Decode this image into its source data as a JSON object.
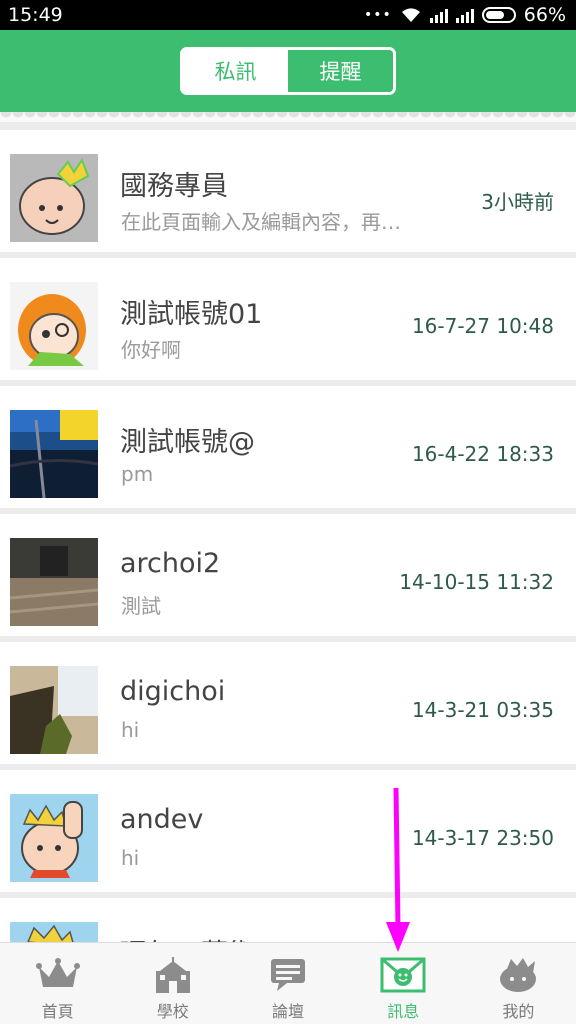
{
  "status_bar": {
    "time": "15:49",
    "dots": "•••",
    "battery": "66%"
  },
  "header": {
    "tabs": [
      {
        "label": "私訊",
        "active": false
      },
      {
        "label": "提醒",
        "active": true
      }
    ]
  },
  "messages": [
    {
      "name": "國務專員",
      "preview": "在此頁面輸入及編輯內容，再…",
      "time": "3小時前",
      "avatar": "crown-baby-avatar"
    },
    {
      "name": "測試帳號01",
      "preview": "你好啊",
      "time": "16-7-27 10:48",
      "avatar": "orange-hood-avatar"
    },
    {
      "name": "測試帳號@",
      "preview": "pm",
      "time": "16-4-22 18:33",
      "avatar": "pool-photo-avatar"
    },
    {
      "name": "archoi2",
      "preview": "測試",
      "time": "14-10-15 11:32",
      "avatar": "floor-photo-avatar"
    },
    {
      "name": "digichoi",
      "preview": "hi",
      "time": "14-3-21 03:35",
      "avatar": "waterfall-photo-avatar"
    },
    {
      "name": "andev",
      "preview": "hi",
      "time": "14-3-17 23:50",
      "avatar": "crown-boy-avatar"
    },
    {
      "name": "環每一藝術",
      "preview": "",
      "time": "",
      "avatar": "partial-avatar"
    }
  ],
  "bottom_nav": [
    {
      "label": "首頁",
      "icon": "crown-icon",
      "active": false
    },
    {
      "label": "學校",
      "icon": "school-icon",
      "active": false
    },
    {
      "label": "論壇",
      "icon": "forum-icon",
      "active": false
    },
    {
      "label": "訊息",
      "icon": "message-icon",
      "active": true
    },
    {
      "label": "我的",
      "icon": "profile-icon",
      "active": false
    }
  ],
  "colors": {
    "brand_green": "#3dbd6f",
    "annotation_arrow": "#ff00ff"
  }
}
